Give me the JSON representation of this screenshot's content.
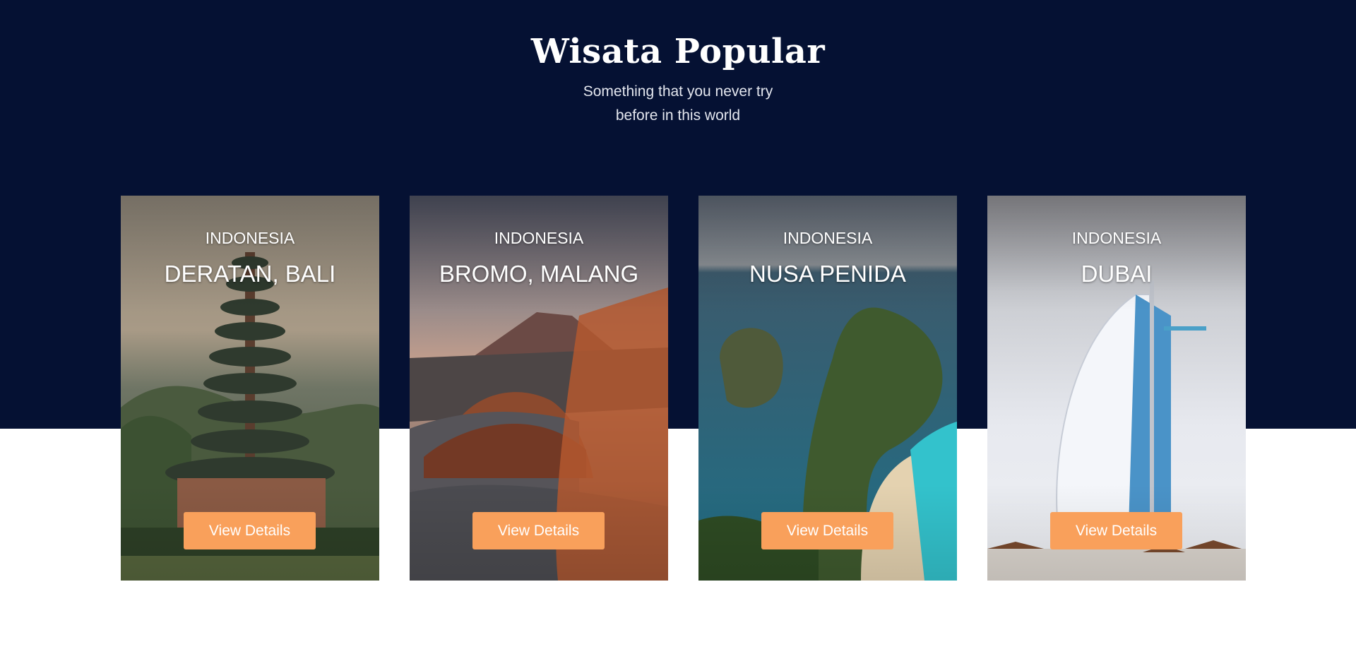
{
  "section": {
    "title": "Wisata Popular",
    "subtitle": "Something that you never try before in this world"
  },
  "colors": {
    "band_background": "#051133",
    "button_background": "#f9a05b",
    "page_background": "#ffffff"
  },
  "cards": [
    {
      "country": "INDONESIA",
      "place": "DERATAN, BALI",
      "button_label": "View Details",
      "image": "pagoda temple by a lake"
    },
    {
      "country": "INDONESIA",
      "place": "BROMO, MALANG",
      "button_label": "View Details",
      "image": "volcano crater landscape"
    },
    {
      "country": "INDONESIA",
      "place": "NUSA PENIDA",
      "button_label": "View Details",
      "image": "sea cliff and turquoise beach"
    },
    {
      "country": "INDONESIA",
      "place": "DUBAI",
      "button_label": "View Details",
      "image": "sail-shaped hotel tower"
    }
  ]
}
